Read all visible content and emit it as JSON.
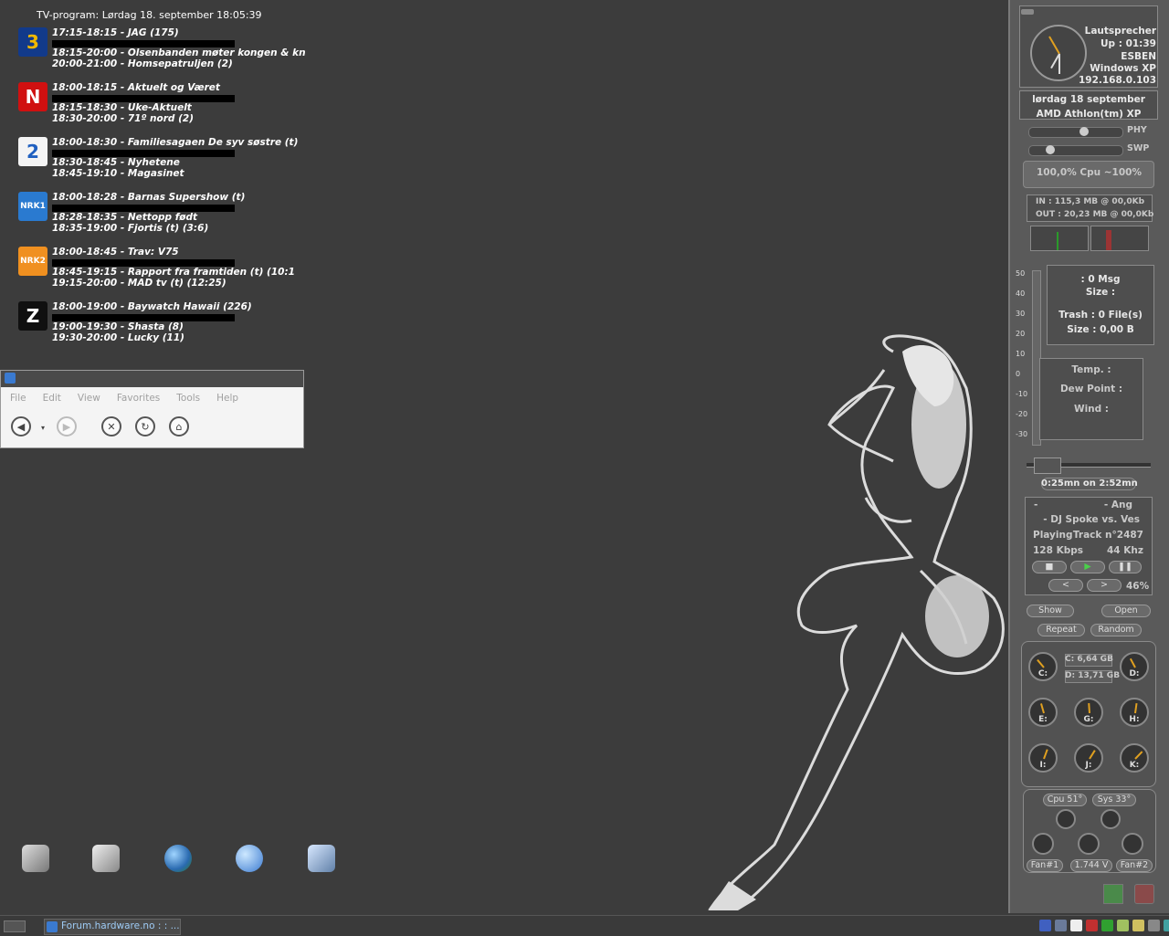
{
  "tv": {
    "title": "TV-program: Lørdag 18. september 18:05:39",
    "channels": [
      {
        "logo": "3",
        "color": "#f0b800",
        "bg": "#123a8a",
        "lines": [
          "17:15-18:15 - JAG (175)",
          "18:15-20:00 - Olsenbanden møter kongen & kn",
          "20:00-21:00 - Homsepatruljen (2)"
        ]
      },
      {
        "logo": "N",
        "color": "#ffffff",
        "bg": "#d01010",
        "lines": [
          "18:00-18:15 - Aktuelt og Været",
          "18:15-18:30 - Uke-Aktuelt",
          "18:30-20:00 - 71º nord (2)"
        ]
      },
      {
        "logo": "2",
        "color": "#2060c0",
        "bg": "#f4f4f4",
        "lines": [
          "18:00-18:30 - Familiesagaen De syv søstre (t)",
          "18:30-18:45 - Nyhetene",
          "18:45-19:10 - Magasinet"
        ]
      },
      {
        "logo": "NRK1",
        "color": "#ffffff",
        "bg": "#2a7ad0",
        "lines": [
          "18:00-18:28 - Barnas Supershow (t)",
          "18:28-18:35 - Nettopp født",
          "18:35-19:00 - Fjortis (t) (3:6)"
        ]
      },
      {
        "logo": "NRK2",
        "color": "#ffffff",
        "bg": "#f09020",
        "lines": [
          "18:00-18:45 - Trav: V75",
          "18:45-19:15 - Rapport fra framtiden (t) (10:1",
          "19:15-20:00 - MAD tv (t) (12:25)"
        ]
      },
      {
        "logo": "Z",
        "color": "#ffffff",
        "bg": "#101010",
        "lines": [
          "18:00-19:00 - Baywatch Hawaii (226)",
          "19:00-19:30 - Shasta (8)",
          "19:30-20:00 - Lucky (11)"
        ]
      }
    ]
  },
  "browser": {
    "menu": [
      "File",
      "Edit",
      "View",
      "Favorites",
      "Tools",
      "Help"
    ]
  },
  "taskbar": {
    "task_label": "Forum.hardware.no : : ..."
  },
  "panel": {
    "clock": {
      "device": "Lautsprecher",
      "uptime": "Up : 01:39",
      "user": "ESBEN",
      "os": "Windows XP",
      "ip": "192.168.0.103"
    },
    "date": "lørdag 18 september",
    "cpu_name": "AMD Athlon(tm) XP",
    "phy_label": "PHY",
    "swp_label": "SWP",
    "phy_level": 0.6,
    "swp_level": 0.2,
    "cpu_load": "100,0%   Cpu   ~100%",
    "net_in": "IN : 115,3 MB   @ 00,0Kb",
    "net_out": "OUT : 20,23 MB @ 00,0Kb",
    "mail_msg": ": 0 Msg",
    "mail_size": "Size :",
    "trash": "Trash : 0 File(s)",
    "trash_size": "Size : 0,00 B",
    "weather_temp": "Temp. :",
    "weather_dew": "Dew Point :",
    "weather_wind": "Wind :",
    "scale": [
      "50",
      "40",
      "30",
      "20",
      "10",
      "0",
      "-10",
      "-20",
      "-30"
    ],
    "progress_text": "0:25mn on 2:52mn",
    "player": {
      "line1_left": "-",
      "line1_right": "- Ang",
      "line2": "- DJ Spoke vs. Ves",
      "status": "Playing",
      "track": "Track n°2487",
      "bitrate": "128 Kbps",
      "freq": "44 Khz",
      "volume": "46%"
    },
    "btn_show": "Show",
    "btn_open": "Open",
    "btn_repeat": "Repeat",
    "btn_random": "Random",
    "drive_c_size": "C: 6,64 GB",
    "drive_d_size": "D: 13,71 GB",
    "drives": [
      "C:",
      "D:",
      "E:",
      "G:",
      "H:",
      "I:",
      "J:",
      "K:"
    ],
    "temp_cpu": "Cpu 51°",
    "temp_sys": "Sys 33°",
    "fan1": "Fan#1",
    "voltage": "1.744 V",
    "fan2": "Fan#2"
  }
}
